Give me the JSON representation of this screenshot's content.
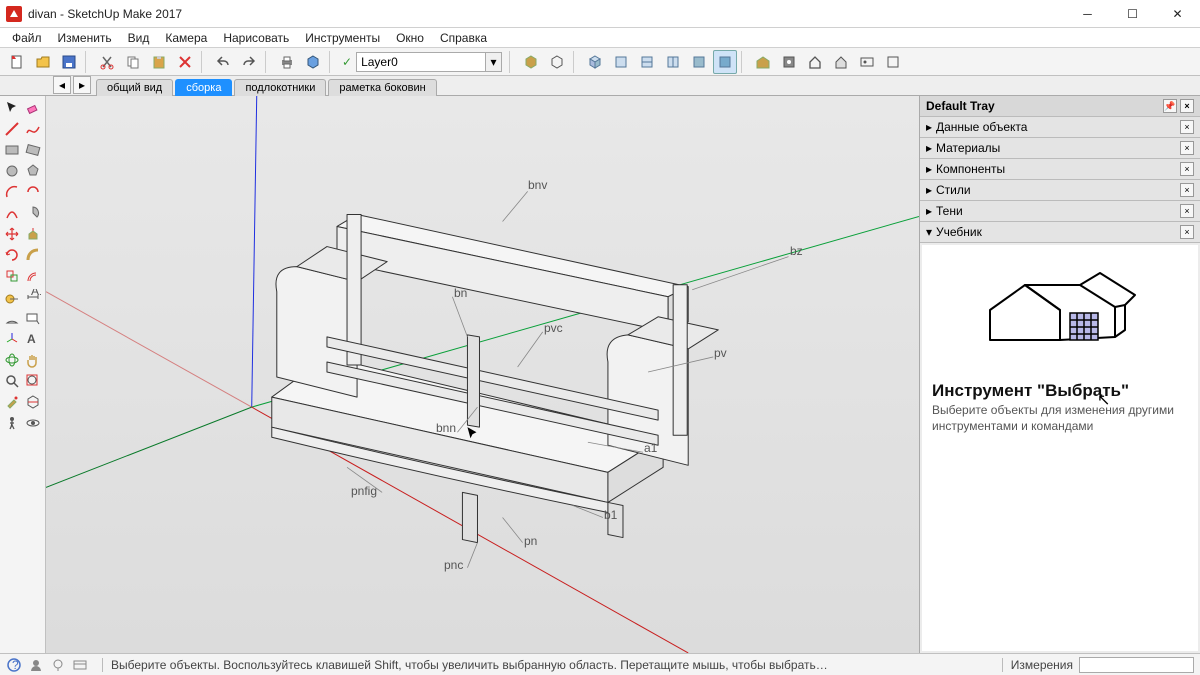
{
  "window": {
    "title": "divan - SketchUp Make 2017"
  },
  "menu": [
    "Файл",
    "Изменить",
    "Вид",
    "Камера",
    "Нарисовать",
    "Инструменты",
    "Окно",
    "Справка"
  ],
  "layer": {
    "value": "Layer0",
    "check": "✓"
  },
  "scenes": {
    "tabs": [
      {
        "label": "общий вид",
        "active": false
      },
      {
        "label": "сборка",
        "active": true
      },
      {
        "label": "подлокотники",
        "active": false
      },
      {
        "label": "раметка боковин",
        "active": false
      }
    ]
  },
  "tray": {
    "title": "Default Tray",
    "panels": [
      {
        "label": "Данные объекта",
        "open": false
      },
      {
        "label": "Материалы",
        "open": false
      },
      {
        "label": "Компоненты",
        "open": false
      },
      {
        "label": "Стили",
        "open": false
      },
      {
        "label": "Тени",
        "open": false
      },
      {
        "label": "Учебник",
        "open": true
      }
    ],
    "instructor": {
      "heading": "Инструмент \"Выбрать\"",
      "body": "Выберите объекты для изменения другими инструментами и командами"
    }
  },
  "status": {
    "hint": "Выберите объекты. Воспользуйтесь клавишей Shift, чтобы увеличить выбранную область. Перетащите мышь, чтобы выбрать несколько об…",
    "measure_label": "Измерения"
  },
  "annotations": [
    "bnv",
    "bz",
    "bn",
    "pvc",
    "pv",
    "bnn",
    "a1",
    "pnfig",
    "b1",
    "pnc",
    "pn"
  ]
}
